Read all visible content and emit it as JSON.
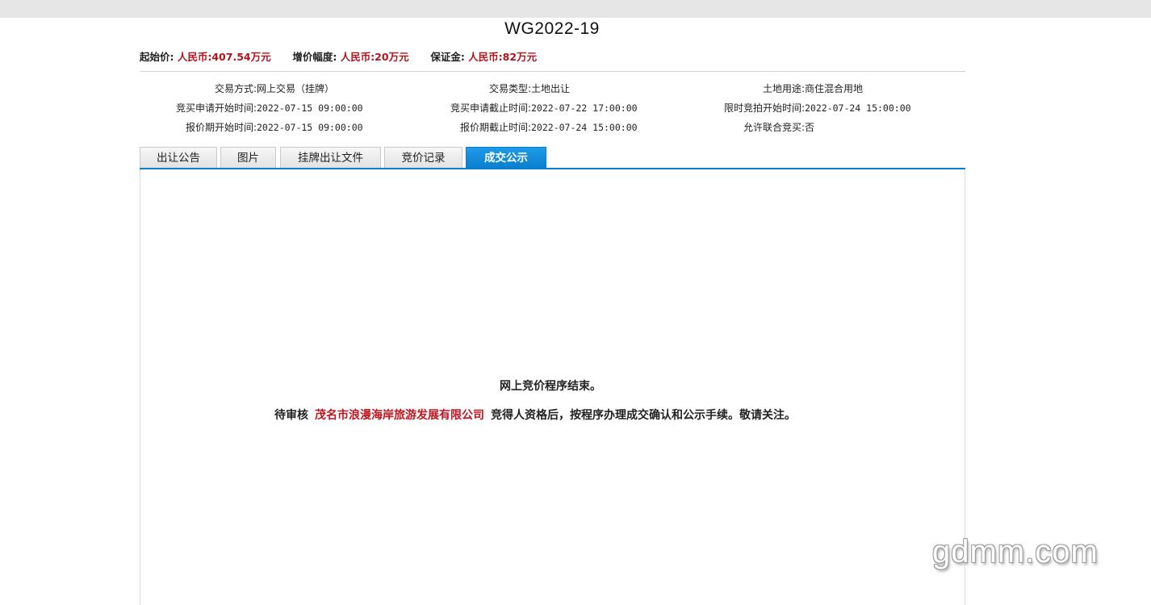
{
  "title": "WG2022-19",
  "prices": {
    "start_label": "起始价:",
    "start_value": "人民币:407.54万元",
    "increment_label": "增价幅度:",
    "increment_value": "人民币:20万元",
    "deposit_label": "保证金:",
    "deposit_value": "人民币:82万元"
  },
  "info": {
    "row1": {
      "c1_k": "交易方式:",
      "c1_v": "网上交易（挂牌）",
      "c2_k": "交易类型:",
      "c2_v": "土地出让",
      "c3_k": "土地用途:",
      "c3_v": "商住混合用地"
    },
    "row2": {
      "c1_k": "竞买申请开始时间:",
      "c1_v": "2022-07-15 09:00:00",
      "c2_k": "竞买申请截止时间:",
      "c2_v": "2022-07-22 17:00:00",
      "c3_k": "限时竞拍开始时间:",
      "c3_v": "2022-07-24 15:00:00"
    },
    "row3": {
      "c1_k": "报价期开始时间:",
      "c1_v": "2022-07-15 09:00:00",
      "c2_k": "报价期截止时间:",
      "c2_v": "2022-07-24 15:00:00",
      "c3_k": "允许联合竞买:",
      "c3_v": "否"
    }
  },
  "tabs": [
    "出让公告",
    "图片",
    "挂牌出让文件",
    "竞价记录",
    "成交公示"
  ],
  "active_tab": "成交公示",
  "result": {
    "line1": "网上竞价程序结束。",
    "prefix": "待审核",
    "company": "茂名市浪漫海岸旅游发展有限公司",
    "suffix": "竞得人资格后，按程序办理成交确认和公示手续。敬请关注。"
  },
  "watermark": "gdmm.com",
  "colors": {
    "accent_blue": "#0a7fd0",
    "price_red": "#b0141c",
    "company_red": "#c0151f"
  }
}
